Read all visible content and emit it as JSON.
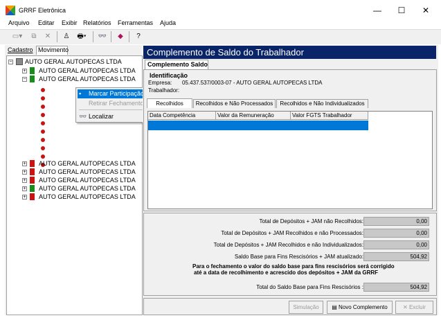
{
  "window": {
    "title": "GRRF Eletrônica",
    "minimize": "—",
    "maximize": "☐",
    "close": "✕"
  },
  "menu": [
    "Arquivo",
    "Editar",
    "Exibir",
    "Relatórios",
    "Ferramentas",
    "Ajuda"
  ],
  "left_tabs": {
    "cadastro": "Cadastro",
    "movimento": "Movimento"
  },
  "tree": {
    "root": "AUTO GERAL AUTOPECAS LTDA",
    "items": [
      "AUTO GERAL AUTOPECAS LTDA",
      "AUTO GERAL AUTOPECAS LTDA",
      "AUTO GERAL AUTOPECAS LTDA",
      "AUTO GERAL AUTOPECAS LTDA",
      "AUTO GERAL AUTOPECAS LTDA",
      "AUTO GERAL AUTOPECAS LTDA",
      "AUTO GERAL AUTOPECAS LTDA"
    ]
  },
  "context_menu": {
    "marcar": "Marcar Participação",
    "retirar": "Retirar Fechamento",
    "localizar": "Localizar"
  },
  "panel": {
    "header": "Complemento de Saldo do Trabalhador",
    "tab": "Complemento Saldo",
    "identificacao": "Identificação",
    "empresa_label": "Empresa:",
    "empresa_value": "05.437.537/0003-07 - AUTO GERAL AUTOPECAS LTDA",
    "trabalhador_label": "Trabalhador:",
    "sub_tabs": [
      "Recolhidos",
      "Recolhidos e Não Processados",
      "Recolhidos e Não Individualizados"
    ],
    "columns": [
      "Data Competência",
      "Valor da Remuneração",
      "Valor FGTS Trabalhador"
    ]
  },
  "summary": {
    "rows": [
      {
        "label": "Total de Depósitos + JAM não Recolhidos:",
        "value": "0,00"
      },
      {
        "label": "Total de Depósitos + JAM Recolhidos e não Processados:",
        "value": "0,00"
      },
      {
        "label": "Total de Depósitos + JAM Recolhidos e não Individualizados:",
        "value": "0,00"
      },
      {
        "label": "Saldo Base para Fins Rescisórios + JAM atualizado:",
        "value": "504,92"
      }
    ],
    "note_line1": "Para o fechamento o valor do saldo base para fins rescisórios será corrigido",
    "note_line2": "até a data de recolhimento e acrescido dos depósitos + JAM da GRRF",
    "total_label": "Total do Saldo Base para Fins Rescisórios :",
    "total_value": "504,92"
  },
  "buttons": {
    "simulacao": "Simulação",
    "novo": "Novo Complemento",
    "excluir": "Excluir"
  },
  "colors": {
    "header": "#0a246a",
    "selection": "#0078d7",
    "flag_green": "#1a8c1a",
    "flag_red": "#cc1111"
  }
}
